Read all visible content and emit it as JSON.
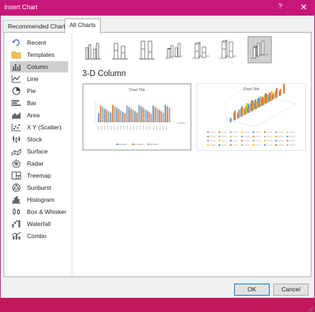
{
  "window": {
    "title": "Insert Chart",
    "help_glyph": "?",
    "close_glyph": "✕"
  },
  "tabs": [
    {
      "label": "Recommended Charts",
      "active": false
    },
    {
      "label": "All Charts",
      "active": true
    }
  ],
  "sidebar": {
    "items": [
      {
        "label": "Recent",
        "icon": "recent-icon",
        "selected": false
      },
      {
        "label": "Templates",
        "icon": "templates-icon",
        "selected": false
      },
      {
        "label": "Column",
        "icon": "column-chart-icon",
        "selected": true
      },
      {
        "label": "Line",
        "icon": "line-chart-icon",
        "selected": false
      },
      {
        "label": "Pie",
        "icon": "pie-chart-icon",
        "selected": false
      },
      {
        "label": "Bar",
        "icon": "bar-chart-icon",
        "selected": false
      },
      {
        "label": "Area",
        "icon": "area-chart-icon",
        "selected": false
      },
      {
        "label": "X Y (Scatter)",
        "icon": "scatter-chart-icon",
        "selected": false
      },
      {
        "label": "Stock",
        "icon": "stock-chart-icon",
        "selected": false
      },
      {
        "label": "Surface",
        "icon": "surface-chart-icon",
        "selected": false
      },
      {
        "label": "Radar",
        "icon": "radar-chart-icon",
        "selected": false
      },
      {
        "label": "Treemap",
        "icon": "treemap-chart-icon",
        "selected": false
      },
      {
        "label": "Sunburst",
        "icon": "sunburst-chart-icon",
        "selected": false
      },
      {
        "label": "Histogram",
        "icon": "histogram-chart-icon",
        "selected": false
      },
      {
        "label": "Box & Whisker",
        "icon": "box-whisker-chart-icon",
        "selected": false
      },
      {
        "label": "Waterfall",
        "icon": "waterfall-chart-icon",
        "selected": false
      },
      {
        "label": "Combo",
        "icon": "combo-chart-icon",
        "selected": false
      }
    ]
  },
  "subtypes": [
    {
      "name": "clustered-column",
      "selected": false
    },
    {
      "name": "stacked-column",
      "selected": false
    },
    {
      "name": "100-percent-stacked-column",
      "selected": false
    },
    {
      "name": "3d-clustered-column",
      "selected": false
    },
    {
      "name": "3d-stacked-column",
      "selected": false
    },
    {
      "name": "3d-100-percent-stacked-column",
      "selected": false
    },
    {
      "name": "3d-column",
      "selected": true
    }
  ],
  "main": {
    "heading": "3-D Column",
    "previews": [
      {
        "title": "Chart Title",
        "selected": true,
        "axis_right": "1st Score",
        "legend": [
          "1st Score",
          "2nd Score",
          "3rd Score"
        ]
      },
      {
        "title": "Chart Title",
        "selected": false
      }
    ]
  },
  "buttons": {
    "ok": "OK",
    "cancel": "Cancel"
  },
  "colors": {
    "titlebar": "#c8177a",
    "series1": "#5b9bd5",
    "series2": "#ed7d31",
    "series3": "#a5a5a5",
    "series4": "#ffc000"
  }
}
